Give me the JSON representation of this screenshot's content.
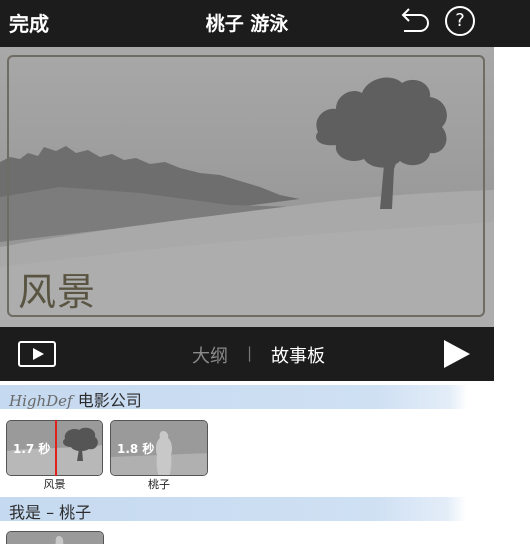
{
  "topbar": {
    "done_label": "完成",
    "title": "桃子 游泳",
    "undo_icon": "undo-icon",
    "help_label": "?"
  },
  "preview": {
    "scene_label": "风景",
    "background_color": "#8f8f8f"
  },
  "controls": {
    "tab_outline": "大纲",
    "separator": "|",
    "tab_storyboard": "故事板",
    "preview_icon": "play-preview-icon",
    "play_icon": "play-icon"
  },
  "storyboard": {
    "section1": {
      "script_text": "HighDef",
      "text": "电影公司"
    },
    "clips": [
      {
        "duration": "1.7 秒",
        "label": "风景"
      },
      {
        "duration": "1.8 秒",
        "label": "桃子"
      }
    ],
    "section2": {
      "text": "我是 – 桃子"
    },
    "band_color": "#c5d9f0",
    "playhead_color": "#e0201c"
  }
}
